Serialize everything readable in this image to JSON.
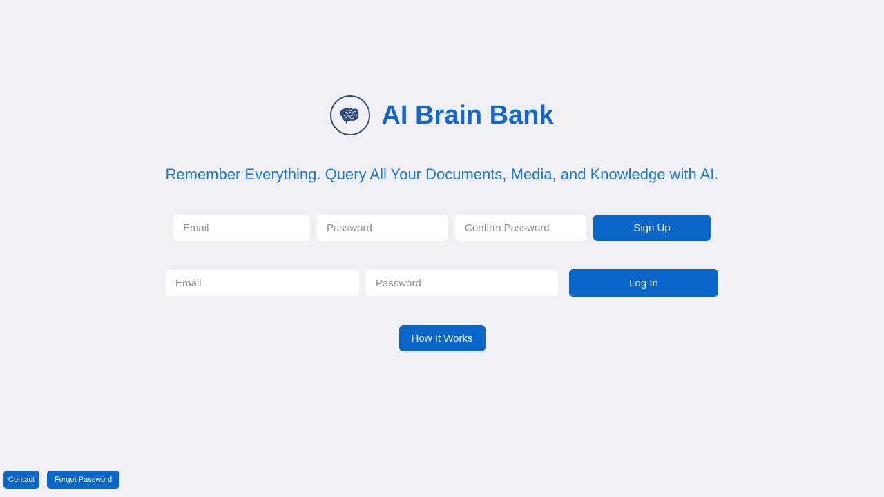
{
  "theme": {
    "background": "#f0eff4",
    "brand_blue": "#1266cc",
    "tagline_blue": "#1a7ad0",
    "button_blue": "#0a66c8",
    "logo_navy": "#2f4f7a",
    "input_background": "#ffffff",
    "placeholder_gray": "#8c8c92"
  },
  "brand": {
    "logo_icon": "brain-icon",
    "title": "AI Brain Bank",
    "tagline": "Remember Everything. Query All Your Documents, Media, and Knowledge with AI."
  },
  "signup_form": {
    "fields": [
      {
        "name": "email",
        "value": "",
        "placeholder": "Email"
      },
      {
        "name": "password",
        "value": "",
        "placeholder": "Password"
      },
      {
        "name": "confirm_password",
        "value": "",
        "placeholder": "Confirm Password"
      }
    ],
    "submit_label": "Sign Up"
  },
  "login_form": {
    "fields": [
      {
        "name": "email",
        "value": "",
        "placeholder": "Email"
      },
      {
        "name": "password",
        "value": "",
        "placeholder": "Password"
      }
    ],
    "submit_label": "Log In"
  },
  "actions": {
    "how_it_works_label": "How It Works"
  },
  "footer": {
    "buttons": [
      {
        "name": "contact",
        "label": "Contact"
      },
      {
        "name": "forgot_password",
        "label": "Forgot Password"
      }
    ]
  }
}
